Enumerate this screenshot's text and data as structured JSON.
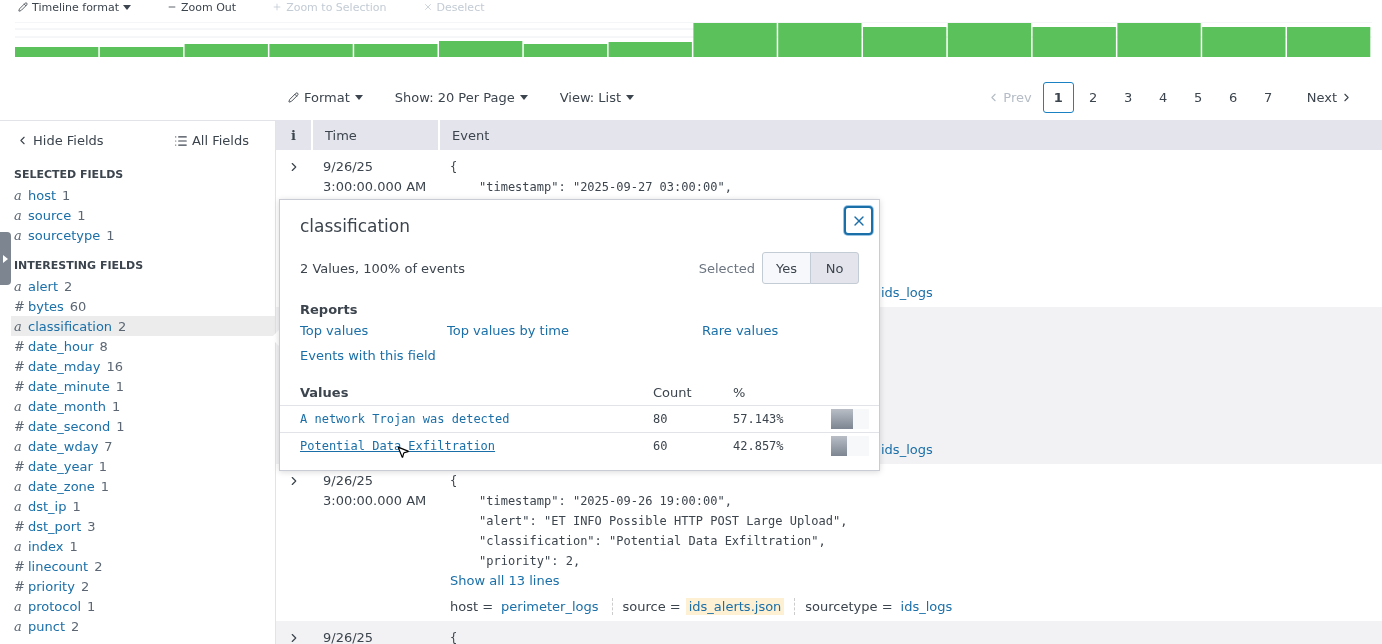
{
  "toolbar": [
    {
      "label": "Timeline format",
      "disabled": false
    },
    {
      "label": "Zoom Out",
      "disabled": false
    },
    {
      "label": "Zoom to Selection",
      "disabled": true
    },
    {
      "label": "Deselect",
      "disabled": true
    }
  ],
  "results_controls": {
    "format": "Format",
    "per_page": "Show: 20 Per Page",
    "view": "View: List"
  },
  "pagination": {
    "prev": {
      "label": "Prev",
      "disabled": true
    },
    "pages": [
      {
        "label": "1",
        "selected": true
      },
      {
        "label": "2",
        "selected": false
      },
      {
        "label": "3",
        "selected": false
      },
      {
        "label": "4",
        "selected": false
      },
      {
        "label": "5",
        "selected": false
      },
      {
        "label": "6",
        "selected": false
      },
      {
        "label": "7",
        "selected": false
      }
    ],
    "next": {
      "label": "Next",
      "disabled": false
    }
  },
  "sidebar": {
    "hide_fields": "Hide Fields",
    "all_fields": "All Fields",
    "sections": [
      {
        "title": "SELECTED FIELDS",
        "fields": [
          {
            "type_icon": "a",
            "name": "host",
            "count": "1",
            "selected": false
          },
          {
            "type_icon": "a",
            "name": "source",
            "count": "1",
            "selected": false
          },
          {
            "type_icon": "a",
            "name": "sourcetype",
            "count": "1",
            "selected": false
          }
        ]
      },
      {
        "title": "INTERESTING FIELDS",
        "fields": [
          {
            "type_icon": "a",
            "name": "alert",
            "count": "2",
            "selected": false
          },
          {
            "type_icon": "#",
            "name": "bytes",
            "count": "60",
            "selected": false
          },
          {
            "type_icon": "a",
            "name": "classification",
            "count": "2",
            "selected": true
          },
          {
            "type_icon": "#",
            "name": "date_hour",
            "count": "8",
            "selected": false
          },
          {
            "type_icon": "#",
            "name": "date_mday",
            "count": "16",
            "selected": false
          },
          {
            "type_icon": "#",
            "name": "date_minute",
            "count": "1",
            "selected": false
          },
          {
            "type_icon": "a",
            "name": "date_month",
            "count": "1",
            "selected": false
          },
          {
            "type_icon": "#",
            "name": "date_second",
            "count": "1",
            "selected": false
          },
          {
            "type_icon": "a",
            "name": "date_wday",
            "count": "7",
            "selected": false
          },
          {
            "type_icon": "#",
            "name": "date_year",
            "count": "1",
            "selected": false
          },
          {
            "type_icon": "a",
            "name": "date_zone",
            "count": "1",
            "selected": false
          },
          {
            "type_icon": "a",
            "name": "dst_ip",
            "count": "1",
            "selected": false
          },
          {
            "type_icon": "#",
            "name": "dst_port",
            "count": "3",
            "selected": false
          },
          {
            "type_icon": "a",
            "name": "index",
            "count": "1",
            "selected": false
          },
          {
            "type_icon": "#",
            "name": "linecount",
            "count": "2",
            "selected": false
          },
          {
            "type_icon": "#",
            "name": "priority",
            "count": "2",
            "selected": false
          },
          {
            "type_icon": "a",
            "name": "protocol",
            "count": "1",
            "selected": false
          },
          {
            "type_icon": "a",
            "name": "punct",
            "count": "2",
            "selected": false
          }
        ]
      }
    ]
  },
  "table": {
    "columns": [
      "i",
      "Time",
      "Event"
    ],
    "rows": [
      {
        "shaded": false,
        "time": [
          "9/26/25",
          "3:00:00.000 AM"
        ],
        "lines": [
          "{",
          "\"timestamp\": \"2025-09-27 03:00:00\","
        ],
        "meta": [
          {
            "value": "ids_logs",
            "highlighted": false
          }
        ]
      },
      {
        "shaded": true,
        "time": [],
        "lines": [],
        "meta": [
          {
            "value": "ids_logs",
            "highlighted": false
          }
        ]
      },
      {
        "shaded": false,
        "time": [
          "9/26/25",
          "3:00:00.000 AM"
        ],
        "lines": [
          "{",
          "\"timestamp\": \"2025-09-26 19:00:00\",",
          "\"alert\": \"ET INFO Possible HTTP POST Large Upload\",",
          "\"classification\": \"Potential Data Exfiltration\",",
          "\"priority\": 2,"
        ],
        "show_all": "Show all 13 lines",
        "meta": [
          {
            "key": "host =",
            "value": "perimeter_logs",
            "highlighted": false
          },
          {
            "key": "source =",
            "value": "ids_alerts.json",
            "highlighted": true
          },
          {
            "key": "sourcetype =",
            "value": "ids_logs",
            "highlighted": false
          }
        ]
      },
      {
        "shaded": true,
        "time": [
          "9/26/25"
        ],
        "lines": [
          "{"
        ],
        "meta": []
      }
    ]
  },
  "popup": {
    "title": "classification",
    "summary": "2 Values, 100% of events",
    "selected_label": "Selected",
    "selected_options": [
      {
        "label": "Yes",
        "selected": false
      },
      {
        "label": "No",
        "selected": true
      }
    ],
    "reports_title": "Reports",
    "reports": [
      "Top values",
      "Top values by time",
      "Rare values",
      "Events with this field"
    ],
    "values_columns": [
      "Values",
      "Count",
      "%"
    ],
    "values": [
      {
        "value": "A network Trojan was detected",
        "count": "80",
        "percent": "57.143%",
        "level": 0.57,
        "hovered": false
      },
      {
        "value": "Potential Data Exfiltration",
        "count": "60",
        "percent": "42.857%",
        "level": 0.43,
        "hovered": true
      }
    ]
  }
}
